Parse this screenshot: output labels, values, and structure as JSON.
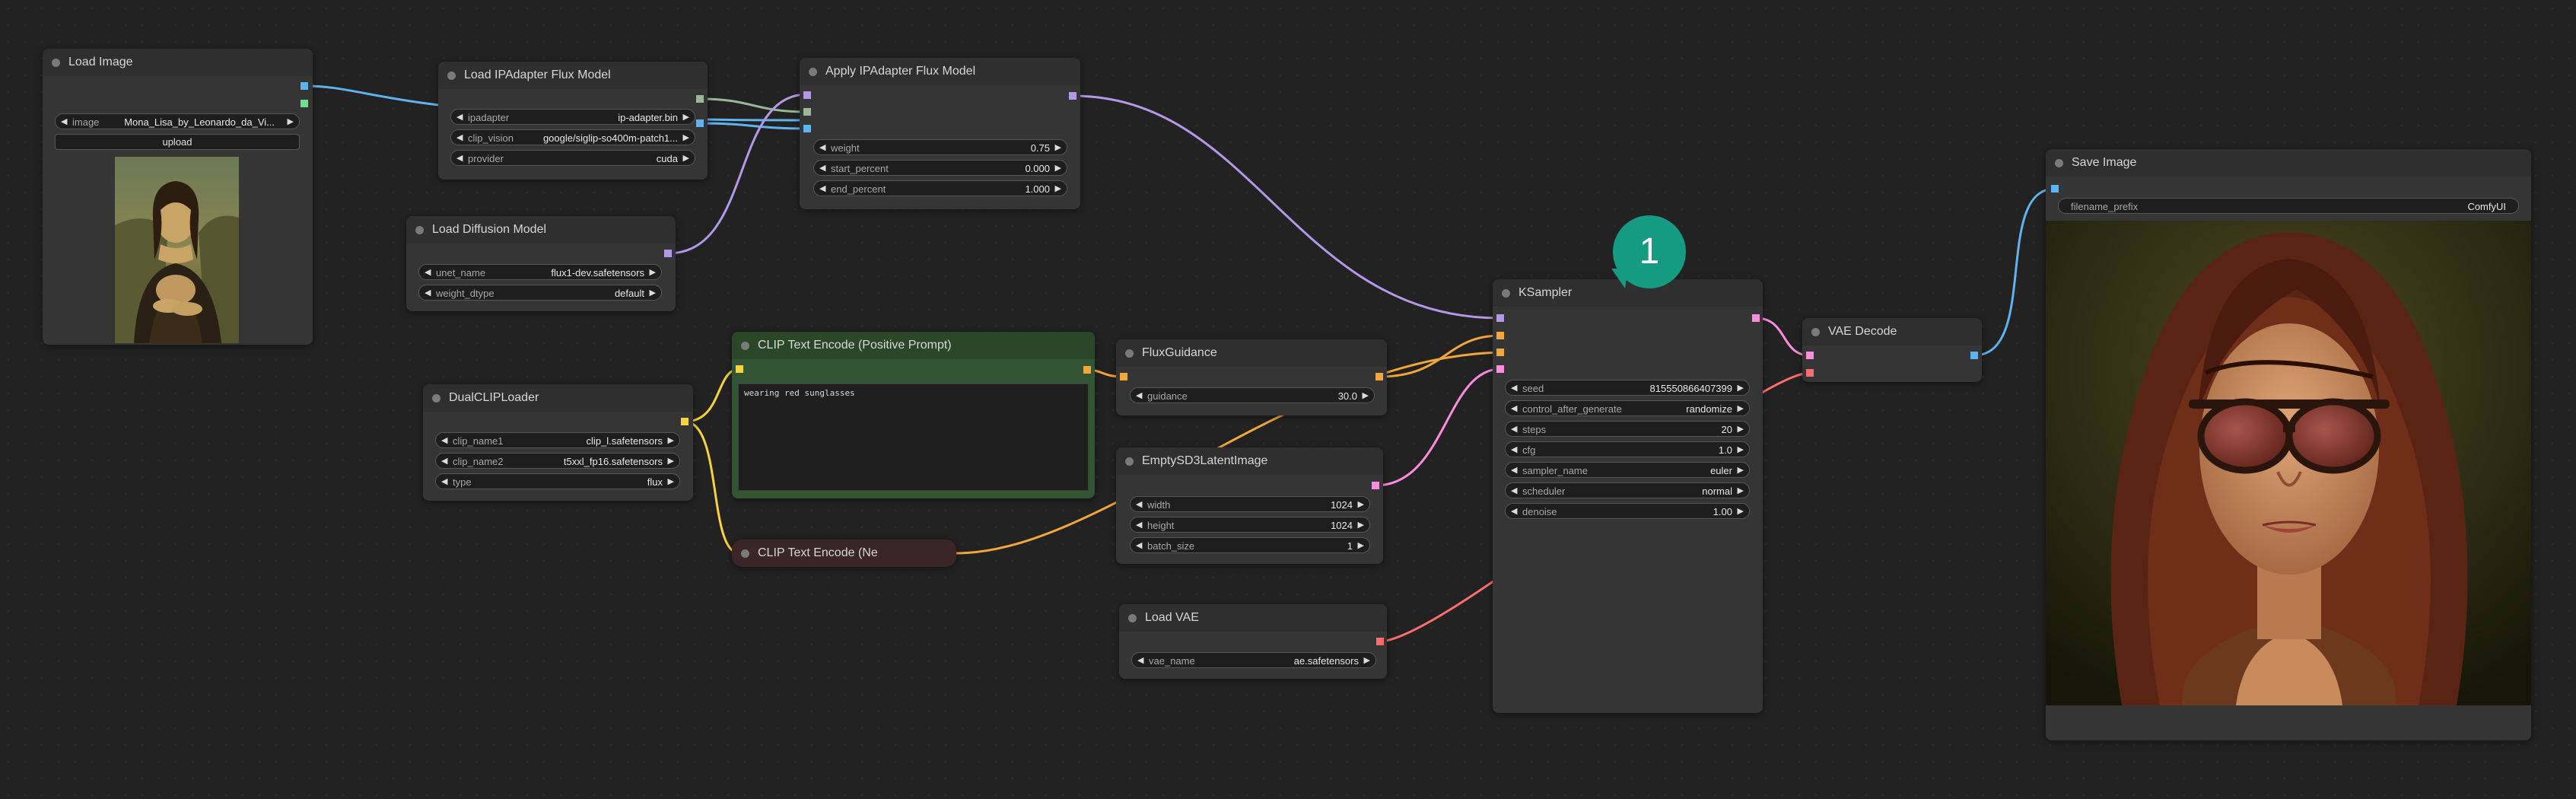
{
  "colors": {
    "canvas": "#222222",
    "node_bg": "#353535",
    "image_wire": "#5eb3f0",
    "model_wire": "#b498e8",
    "clip_wire": "#f5d33a",
    "conditioning_wire": "#f3a73a",
    "latent_wire": "#ff8ce0",
    "vae_wire": "#ff6e6e",
    "ipadapter_wire": "#9ab896",
    "clip_vision_wire": "#5eb3f0",
    "badge": "#149b82"
  },
  "badge": {
    "label": "1"
  },
  "nodes": {
    "load_image": {
      "title": "Load Image",
      "image_label": "image",
      "image_value": "Mona_Lisa_by_Leonardo_da_Vi...",
      "upload_label": "upload",
      "preview_icon": "mona-lisa-painting"
    },
    "load_ipadapter": {
      "title": "Load IPAdapter Flux Model",
      "ipadapter_label": "ipadapter",
      "ipadapter_value": "ip-adapter.bin",
      "clip_vision_label": "clip_vision",
      "clip_vision_value": "google/siglip-so400m-patch1...",
      "provider_label": "provider",
      "provider_value": "cuda"
    },
    "apply_ipadapter": {
      "title": "Apply IPAdapter Flux Model",
      "weight_label": "weight",
      "weight_value": "0.75",
      "start_label": "start_percent",
      "start_value": "0.000",
      "end_label": "end_percent",
      "end_value": "1.000"
    },
    "load_diffusion": {
      "title": "Load Diffusion Model",
      "unet_label": "unet_name",
      "unet_value": "flux1-dev.safetensors",
      "dtype_label": "weight_dtype",
      "dtype_value": "default"
    },
    "dual_clip": {
      "title": "DualCLIPLoader",
      "clip1_label": "clip_name1",
      "clip1_value": "clip_l.safetensors",
      "clip2_label": "clip_name2",
      "clip2_value": "t5xxl_fp16.safetensors",
      "type_label": "type",
      "type_value": "flux"
    },
    "clip_positive": {
      "title": "CLIP Text Encode (Positive Prompt)",
      "prompt": "wearing red sunglasses"
    },
    "clip_negative": {
      "title": "CLIP Text Encode (Ne"
    },
    "flux_guidance": {
      "title": "FluxGuidance",
      "guidance_label": "guidance",
      "guidance_value": "30.0"
    },
    "empty_latent": {
      "title": "EmptySD3LatentImage",
      "width_label": "width",
      "width_value": "1024",
      "height_label": "height",
      "height_value": "1024",
      "batch_label": "batch_size",
      "batch_value": "1"
    },
    "load_vae": {
      "title": "Load VAE",
      "vae_label": "vae_name",
      "vae_value": "ae.safetensors"
    },
    "ksampler": {
      "title": "KSampler",
      "seed_label": "seed",
      "seed_value": "815550866407399",
      "control_label": "control_after_generate",
      "control_value": "randomize",
      "steps_label": "steps",
      "steps_value": "20",
      "cfg_label": "cfg",
      "cfg_value": "1.0",
      "sampler_label": "sampler_name",
      "sampler_value": "euler",
      "scheduler_label": "scheduler",
      "scheduler_value": "normal",
      "denoise_label": "denoise",
      "denoise_value": "1.00"
    },
    "vae_decode": {
      "title": "VAE Decode"
    },
    "save_image": {
      "title": "Save Image",
      "prefix_label": "filename_prefix",
      "prefix_value": "ComfyUI",
      "preview_icon": "generated-portrait-red-sunglasses"
    }
  }
}
